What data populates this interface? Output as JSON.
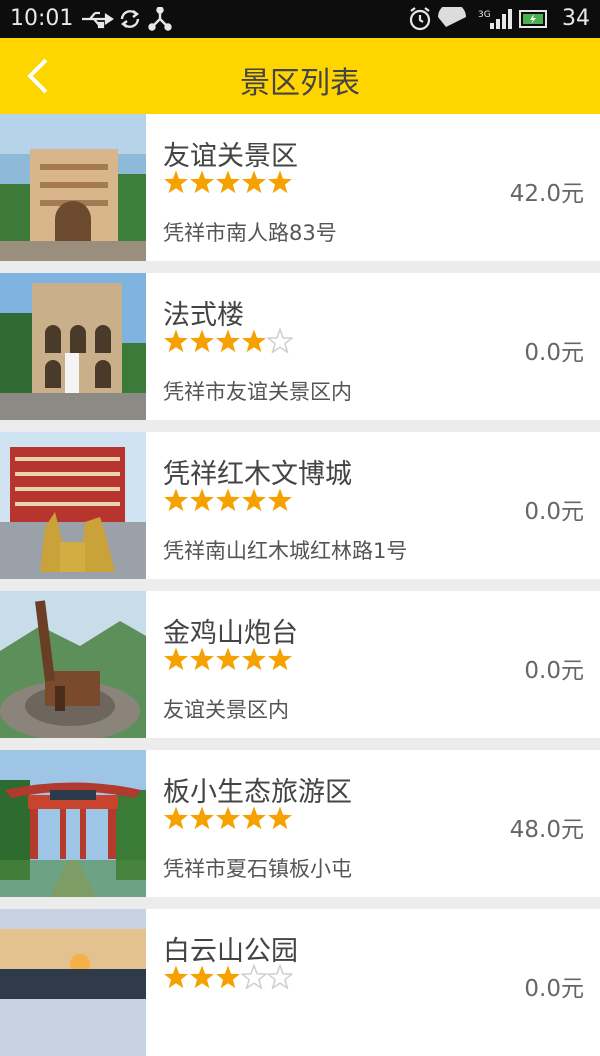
{
  "status_bar": {
    "time": "10:01",
    "network": "3G",
    "battery": "34",
    "icons": [
      "usb-icon",
      "sync-icon",
      "share-icon",
      "alarm-icon",
      "wifi-icon",
      "signal-icon",
      "battery-icon"
    ]
  },
  "header": {
    "title": "景区列表",
    "back_icon": "back-chevron-icon",
    "color": "#ffd500"
  },
  "colors": {
    "star_filled": "#f5a100",
    "star_empty": "#cccccc"
  },
  "items": [
    {
      "name": "友谊关景区",
      "rating": 5,
      "price": "42.0元",
      "address": "凭祥市南人路83号"
    },
    {
      "name": "法式楼",
      "rating": 4,
      "price": "0.0元",
      "address": "凭祥市友谊关景区内"
    },
    {
      "name": "凭祥红木文博城",
      "rating": 5,
      "price": "0.0元",
      "address": "凭祥南山红木城红林路1号"
    },
    {
      "name": "金鸡山炮台",
      "rating": 5,
      "price": "0.0元",
      "address": "友谊关景区内"
    },
    {
      "name": "板小生态旅游区",
      "rating": 5,
      "price": "48.0元",
      "address": "凭祥市夏石镇板小屯"
    },
    {
      "name": "白云山公园",
      "rating": 3,
      "price": "0.0元",
      "address": ""
    }
  ]
}
